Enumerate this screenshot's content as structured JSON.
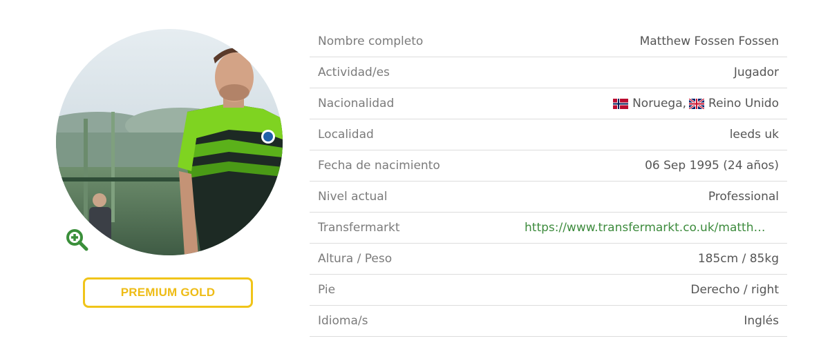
{
  "profile": {
    "premium_label": "PREMIUM GOLD"
  },
  "info": {
    "rows": [
      {
        "label": "Nombre completo",
        "value": "Matthew Fossen Fossen"
      },
      {
        "label": "Actividad/es",
        "value": "Jugador"
      },
      {
        "label": "Nacionalidad",
        "value": ""
      },
      {
        "label": "Localidad",
        "value": "leeds uk"
      },
      {
        "label": "Fecha de nacimiento",
        "value": "06 Sep 1995 (24 años)"
      },
      {
        "label": "Nivel actual",
        "value": "Professional"
      },
      {
        "label": "Transfermarkt",
        "value": "https://www.transfermarkt.co.uk/matthe..."
      },
      {
        "label": "Altura / Peso",
        "value": "185cm / 85kg"
      },
      {
        "label": "Pie",
        "value": "Derecho / right"
      },
      {
        "label": "Idioma/s",
        "value": "Inglés"
      }
    ],
    "nationalities": [
      {
        "country": "Noruega",
        "flag": "norway-flag-icon"
      },
      {
        "country": "Reino Unido",
        "flag": "uk-flag-icon"
      }
    ]
  },
  "colors": {
    "accent_gold": "#f0c419",
    "link_green": "#3d8b3d",
    "kit_green": "#7fd321"
  }
}
